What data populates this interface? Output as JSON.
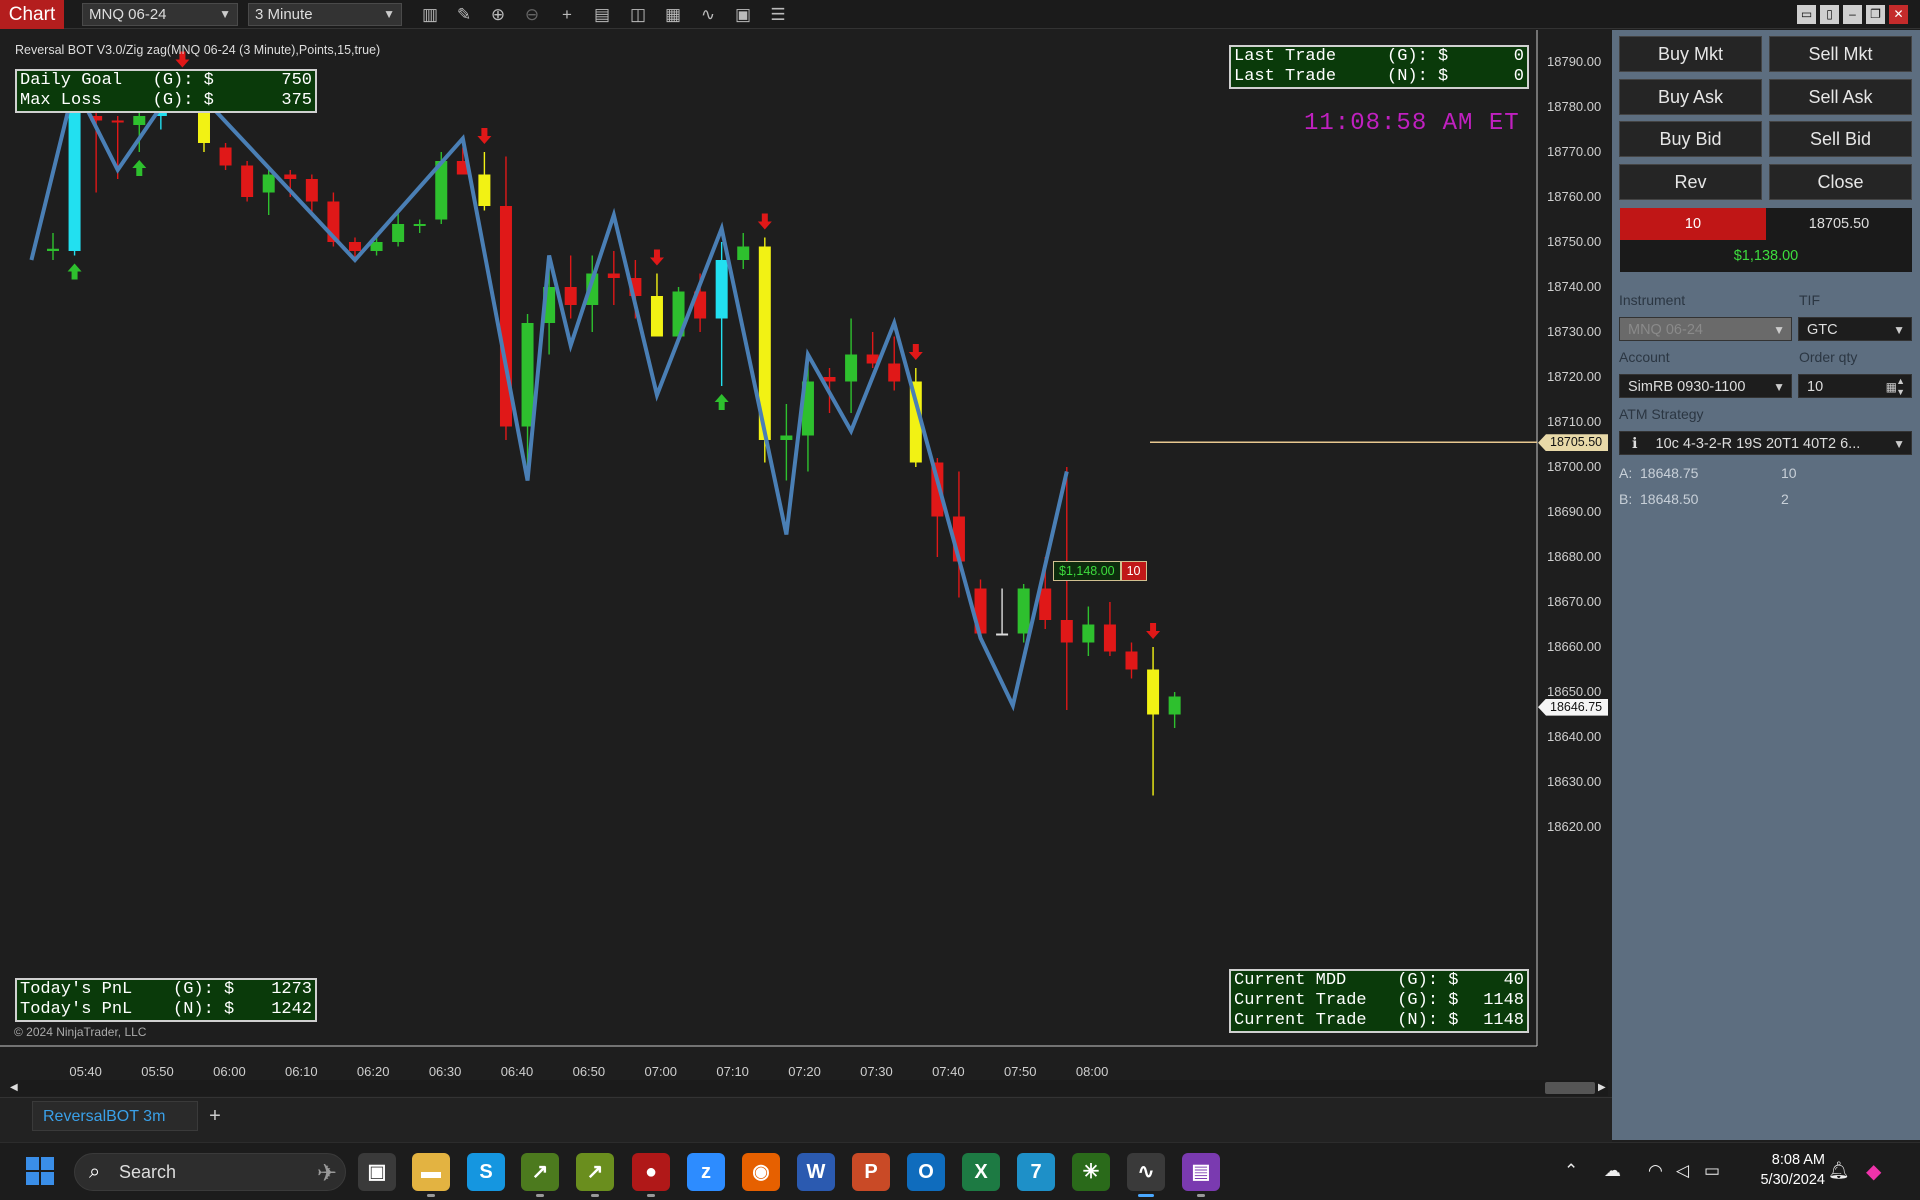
{
  "toolbar": {
    "chart_tab": "Chart",
    "instrument": "MNQ 06-24",
    "interval": "3 Minute",
    "icons": [
      "bar-type-icon",
      "draw-pencil-icon",
      "zoom-in-icon",
      "zoom-out-icon",
      "crosshair-icon",
      "data-box-icon",
      "templates-icon",
      "strategies-icon",
      "indicators-icon",
      "properties-icon",
      "menu-list-icon"
    ]
  },
  "chart": {
    "indicator_label": "Reversal BOT V3.0/Zig zag(MNQ 06-24 (3 Minute),Points,15,true)",
    "clock": "11:08:58 AM ET",
    "copyright": "© 2024 NinjaTrader, LLC",
    "goal_box": [
      {
        "label": "Daily Goal   (G): $",
        "value": "750"
      },
      {
        "label": "Max Loss     (G): $",
        "value": "375"
      }
    ],
    "last_trade_box": [
      {
        "label": "Last Trade     (G): $",
        "value": "0"
      },
      {
        "label": "Last Trade     (N): $",
        "value": "0"
      }
    ],
    "pnl_box": [
      {
        "label": "Today's PnL    (G): $",
        "value": "1273"
      },
      {
        "label": "Today's PnL    (N): $",
        "value": "1242"
      }
    ],
    "current_box": [
      {
        "label": "Current MDD     (G): $",
        "value": "40"
      },
      {
        "label": "Current Trade   (G): $",
        "value": "1148"
      },
      {
        "label": "Current Trade   (N): $",
        "value": "1148"
      }
    ],
    "position_label": {
      "pnl": "$1,148.00",
      "qty": "10"
    },
    "price_ticks": [
      "18790.00",
      "18780.00",
      "18770.00",
      "18760.00",
      "18750.00",
      "18740.00",
      "18730.00",
      "18720.00",
      "18710.00",
      "18700.00",
      "18690.00",
      "18680.00",
      "18670.00",
      "18660.00",
      "18650.00",
      "18640.00",
      "18630.00",
      "18620.00"
    ],
    "position_price_tag": "18705.50",
    "last_price_tag": "18646.75",
    "time_ticks": [
      "05:40",
      "05:50",
      "06:00",
      "06:10",
      "06:20",
      "06:30",
      "06:40",
      "06:50",
      "07:00",
      "07:10",
      "07:20",
      "07:30",
      "07:40",
      "07:50",
      "08:00"
    ]
  },
  "chart_data": {
    "type": "candlestick",
    "x_unit": "bar index (3 minute bars)",
    "ylim": [
      18614,
      18800
    ],
    "candles": [
      {
        "i": 0,
        "o": 18748,
        "h": 18752,
        "l": 18746,
        "c": 18748.5,
        "color": "green"
      },
      {
        "i": 1,
        "o": 18748,
        "h": 18785,
        "l": 18747,
        "c": 18780,
        "color": "cyan"
      },
      {
        "i": 2,
        "o": 18778,
        "h": 18779,
        "l": 18761,
        "c": 18777,
        "color": "red"
      },
      {
        "i": 3,
        "o": 18777,
        "h": 18778,
        "l": 18764,
        "c": 18777,
        "color": "red"
      },
      {
        "i": 4,
        "o": 18776,
        "h": 18780,
        "l": 18770,
        "c": 18778,
        "color": "green"
      },
      {
        "i": 5,
        "o": 18778,
        "h": 18784,
        "l": 18775,
        "c": 18782,
        "color": "cyan"
      },
      {
        "i": 6,
        "o": 18782,
        "h": 18787,
        "l": 18779,
        "c": 18780,
        "color": "red"
      },
      {
        "i": 7,
        "o": 18779,
        "h": 18780,
        "l": 18770,
        "c": 18772,
        "color": "yellow"
      },
      {
        "i": 8,
        "o": 18771,
        "h": 18772,
        "l": 18766,
        "c": 18767,
        "color": "red"
      },
      {
        "i": 9,
        "o": 18767,
        "h": 18768,
        "l": 18759,
        "c": 18760,
        "color": "red"
      },
      {
        "i": 10,
        "o": 18761,
        "h": 18767,
        "l": 18756,
        "c": 18765,
        "color": "green"
      },
      {
        "i": 11,
        "o": 18765,
        "h": 18766,
        "l": 18760,
        "c": 18764,
        "color": "red"
      },
      {
        "i": 12,
        "o": 18764,
        "h": 18765,
        "l": 18756,
        "c": 18759,
        "color": "red"
      },
      {
        "i": 13,
        "o": 18759,
        "h": 18761,
        "l": 18749,
        "c": 18750,
        "color": "red"
      },
      {
        "i": 14,
        "o": 18750,
        "h": 18751,
        "l": 18746,
        "c": 18748,
        "color": "red"
      },
      {
        "i": 15,
        "o": 18748,
        "h": 18752,
        "l": 18747,
        "c": 18750,
        "color": "green"
      },
      {
        "i": 16,
        "o": 18750,
        "h": 18757,
        "l": 18749,
        "c": 18754,
        "color": "green"
      },
      {
        "i": 17,
        "o": 18754,
        "h": 18755,
        "l": 18752,
        "c": 18754,
        "color": "green"
      },
      {
        "i": 18,
        "o": 18755,
        "h": 18770,
        "l": 18754,
        "c": 18768,
        "color": "green"
      },
      {
        "i": 19,
        "o": 18768,
        "h": 18771,
        "l": 18765,
        "c": 18765,
        "color": "red"
      },
      {
        "i": 20,
        "o": 18765,
        "h": 18770,
        "l": 18757,
        "c": 18758,
        "color": "yellow"
      },
      {
        "i": 21,
        "o": 18758,
        "h": 18769,
        "l": 18706,
        "c": 18709,
        "color": "red"
      },
      {
        "i": 22,
        "o": 18709,
        "h": 18734,
        "l": 18697,
        "c": 18732,
        "color": "green"
      },
      {
        "i": 23,
        "o": 18732,
        "h": 18745,
        "l": 18725,
        "c": 18740,
        "color": "green"
      },
      {
        "i": 24,
        "o": 18740,
        "h": 18747,
        "l": 18733,
        "c": 18736,
        "color": "red"
      },
      {
        "i": 25,
        "o": 18736,
        "h": 18747,
        "l": 18730,
        "c": 18743,
        "color": "green"
      },
      {
        "i": 26,
        "o": 18743,
        "h": 18748,
        "l": 18736,
        "c": 18742,
        "color": "red"
      },
      {
        "i": 27,
        "o": 18742,
        "h": 18746,
        "l": 18733,
        "c": 18738,
        "color": "red"
      },
      {
        "i": 28,
        "o": 18738,
        "h": 18743,
        "l": 18729,
        "c": 18729,
        "color": "yellow"
      },
      {
        "i": 29,
        "o": 18729,
        "h": 18740,
        "l": 18729,
        "c": 18739,
        "color": "green"
      },
      {
        "i": 30,
        "o": 18739,
        "h": 18743,
        "l": 18730,
        "c": 18733,
        "color": "red"
      },
      {
        "i": 31,
        "o": 18733,
        "h": 18750,
        "l": 18718,
        "c": 18746,
        "color": "cyan"
      },
      {
        "i": 32,
        "o": 18746,
        "h": 18752,
        "l": 18744,
        "c": 18749,
        "color": "green"
      },
      {
        "i": 33,
        "o": 18749,
        "h": 18751,
        "l": 18701,
        "c": 18706,
        "color": "yellow"
      },
      {
        "i": 34,
        "o": 18706,
        "h": 18714,
        "l": 18697,
        "c": 18707,
        "color": "green"
      },
      {
        "i": 35,
        "o": 18707,
        "h": 18724,
        "l": 18699,
        "c": 18719,
        "color": "green"
      },
      {
        "i": 36,
        "o": 18720,
        "h": 18722,
        "l": 18712,
        "c": 18719,
        "color": "red"
      },
      {
        "i": 37,
        "o": 18719,
        "h": 18733,
        "l": 18712,
        "c": 18725,
        "color": "green"
      },
      {
        "i": 38,
        "o": 18725,
        "h": 18730,
        "l": 18722,
        "c": 18723,
        "color": "red"
      },
      {
        "i": 39,
        "o": 18723,
        "h": 18729,
        "l": 18717,
        "c": 18719,
        "color": "red"
      },
      {
        "i": 40,
        "o": 18719,
        "h": 18722,
        "l": 18700,
        "c": 18701,
        "color": "yellow"
      },
      {
        "i": 41,
        "o": 18701,
        "h": 18702,
        "l": 18680,
        "c": 18689,
        "color": "red"
      },
      {
        "i": 42,
        "o": 18689,
        "h": 18699,
        "l": 18671,
        "c": 18679,
        "color": "red"
      },
      {
        "i": 43,
        "o": 18673,
        "h": 18675,
        "l": 18662,
        "c": 18663,
        "color": "red"
      },
      {
        "i": 44,
        "o": 18663,
        "h": 18673,
        "l": 18663,
        "c": 18663,
        "color": "white"
      },
      {
        "i": 45,
        "o": 18663,
        "h": 18674,
        "l": 18661,
        "c": 18673,
        "color": "green"
      },
      {
        "i": 46,
        "o": 18673,
        "h": 18680,
        "l": 18664,
        "c": 18666,
        "color": "red"
      },
      {
        "i": 47,
        "o": 18666,
        "h": 18700,
        "l": 18646,
        "c": 18661,
        "color": "red"
      },
      {
        "i": 48,
        "o": 18661,
        "h": 18669,
        "l": 18658,
        "c": 18665,
        "color": "green"
      },
      {
        "i": 49,
        "o": 18665,
        "h": 18670,
        "l": 18658,
        "c": 18659,
        "color": "red"
      },
      {
        "i": 50,
        "o": 18659,
        "h": 18661,
        "l": 18653,
        "c": 18655,
        "color": "red"
      },
      {
        "i": 51,
        "o": 18655,
        "h": 18660,
        "l": 18627,
        "c": 18645,
        "color": "yellow"
      },
      {
        "i": 52,
        "o": 18645,
        "h": 18650,
        "l": 18642,
        "c": 18649,
        "color": "green"
      }
    ],
    "zigzag": [
      {
        "i": -1,
        "p": 18746
      },
      {
        "i": 1,
        "p": 18785
      },
      {
        "i": 3,
        "p": 18766
      },
      {
        "i": 6,
        "p": 18787
      },
      {
        "i": 14,
        "p": 18746
      },
      {
        "i": 19,
        "p": 18773
      },
      {
        "i": 22,
        "p": 18697
      },
      {
        "i": 23,
        "p": 18747
      },
      {
        "i": 24,
        "p": 18727
      },
      {
        "i": 26,
        "p": 18756
      },
      {
        "i": 28,
        "p": 18716
      },
      {
        "i": 31,
        "p": 18753
      },
      {
        "i": 34,
        "p": 18685
      },
      {
        "i": 35,
        "p": 18725
      },
      {
        "i": 37,
        "p": 18708
      },
      {
        "i": 39,
        "p": 18732
      },
      {
        "i": 43,
        "p": 18662
      },
      {
        "i": 44.5,
        "p": 18647
      },
      {
        "i": 47,
        "p": 18699
      }
    ],
    "signals": [
      {
        "i": 1,
        "type": "up"
      },
      {
        "i": 4,
        "type": "up"
      },
      {
        "i": 6,
        "type": "down"
      },
      {
        "i": 20,
        "type": "down"
      },
      {
        "i": 28,
        "type": "down"
      },
      {
        "i": 31,
        "type": "up"
      },
      {
        "i": 33,
        "type": "down"
      },
      {
        "i": 40,
        "type": "down"
      },
      {
        "i": 51,
        "type": "down"
      }
    ],
    "position_price": 18705.5,
    "last_price": 18646.75
  },
  "panel": {
    "buttons": [
      {
        "label": "Buy Mkt",
        "name": "buy-mkt-button"
      },
      {
        "label": "Sell Mkt",
        "name": "sell-mkt-button"
      },
      {
        "label": "Buy Ask",
        "name": "buy-ask-button"
      },
      {
        "label": "Sell Ask",
        "name": "sell-ask-button"
      },
      {
        "label": "Buy Bid",
        "name": "buy-bid-button"
      },
      {
        "label": "Sell Bid",
        "name": "sell-bid-button"
      },
      {
        "label": "Rev",
        "name": "rev-button"
      },
      {
        "label": "Close",
        "name": "close-button"
      }
    ],
    "position_qty": "10",
    "position_price": "18705.50",
    "position_pnl": "$1,138.00",
    "instrument_label": "Instrument",
    "instrument_value": "MNQ 06-24",
    "tif_label": "TIF",
    "tif_value": "GTC",
    "account_label": "Account",
    "account_value": "SimRB 0930-1100",
    "order_qty_label": "Order qty",
    "order_qty_value": "10",
    "atm_label": "ATM Strategy",
    "atm_value": "10c 4-3-2-R 19S 20T1 40T2 6...",
    "bracket_a_label": "A:",
    "bracket_a_price": "18648.75",
    "bracket_a_qty": "10",
    "bracket_b_label": "B:",
    "bracket_b_price": "18648.50",
    "bracket_b_qty": "2"
  },
  "bottom": {
    "tab_label": "ReversalBOT 3m",
    "add_tab": "+"
  },
  "taskbar": {
    "search_placeholder": "Search",
    "time": "8:08 AM",
    "date": "5/30/2024",
    "apps": [
      {
        "name": "task-view-icon",
        "glyph": "▣",
        "bg": "#3a3a3a"
      },
      {
        "name": "file-explorer-icon",
        "glyph": "▬",
        "bg": "#e3b341"
      },
      {
        "name": "skype-icon",
        "glyph": "S",
        "bg": "#1596e0"
      },
      {
        "name": "app-green-1-icon",
        "glyph": "↗",
        "bg": "#4c7a1e"
      },
      {
        "name": "app-green-2-icon",
        "glyph": "↗",
        "bg": "#6a8e1e"
      },
      {
        "name": "record-icon",
        "glyph": "●",
        "bg": "#b01818"
      },
      {
        "name": "zoom-icon",
        "glyph": "z",
        "bg": "#2d8cff"
      },
      {
        "name": "firefox-icon",
        "glyph": "◉",
        "bg": "#e66000"
      },
      {
        "name": "word-icon",
        "glyph": "W",
        "bg": "#2b5ab0"
      },
      {
        "name": "powerpoint-icon",
        "glyph": "P",
        "bg": "#c94a26"
      },
      {
        "name": "outlook-icon",
        "glyph": "O",
        "bg": "#0f6cbd"
      },
      {
        "name": "excel-icon",
        "glyph": "X",
        "bg": "#1d7a43"
      },
      {
        "name": "tradingview-icon",
        "glyph": "7",
        "bg": "#1e90c8"
      },
      {
        "name": "app-leaf-icon",
        "glyph": "✳",
        "bg": "#2a6a1a"
      },
      {
        "name": "ninjatrader-icon",
        "glyph": "∿",
        "bg": "#3a3a3a"
      },
      {
        "name": "clipchamp-icon",
        "glyph": "▤",
        "bg": "#7a3ab0"
      }
    ]
  }
}
